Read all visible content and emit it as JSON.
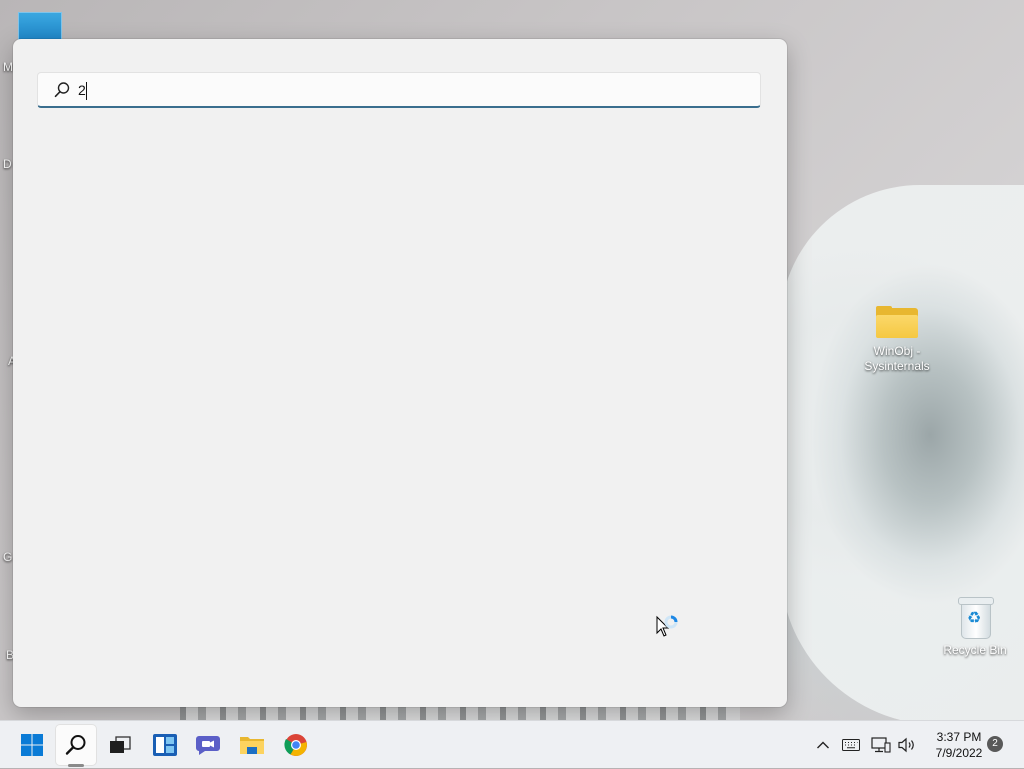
{
  "desktop": {
    "left_icon_chars": [
      "M",
      "D",
      "A",
      "G",
      "B"
    ],
    "icons": [
      {
        "label": "WinObj - Sysinternals",
        "icon": "folder-icon"
      },
      {
        "label": "Recycle Bin",
        "icon": "recycle-bin-icon"
      }
    ]
  },
  "search": {
    "query": "2",
    "icon": "search-icon"
  },
  "taskbar": {
    "apps": [
      {
        "name": "Start",
        "icon": "windows-logo-icon"
      },
      {
        "name": "Search",
        "icon": "search-icon",
        "active": true
      },
      {
        "name": "Task View",
        "icon": "task-view-icon"
      },
      {
        "name": "Widgets",
        "icon": "widgets-icon"
      },
      {
        "name": "Chat",
        "icon": "chat-icon"
      },
      {
        "name": "File Explorer",
        "icon": "folder-icon"
      },
      {
        "name": "Google Chrome",
        "icon": "chrome-icon"
      }
    ],
    "tray": {
      "icons": [
        "chevron-up-icon",
        "keyboard-icon",
        "network-icon",
        "volume-icon"
      ],
      "time": "3:37 PM",
      "date": "7/9/2022",
      "notification_count": "2"
    }
  },
  "colors": {
    "panel_bg": "#f1f1f1",
    "search_underline": "#3a6e8e",
    "taskbar_bg": "#eef0f3",
    "windows_blue": "#0078d4"
  }
}
